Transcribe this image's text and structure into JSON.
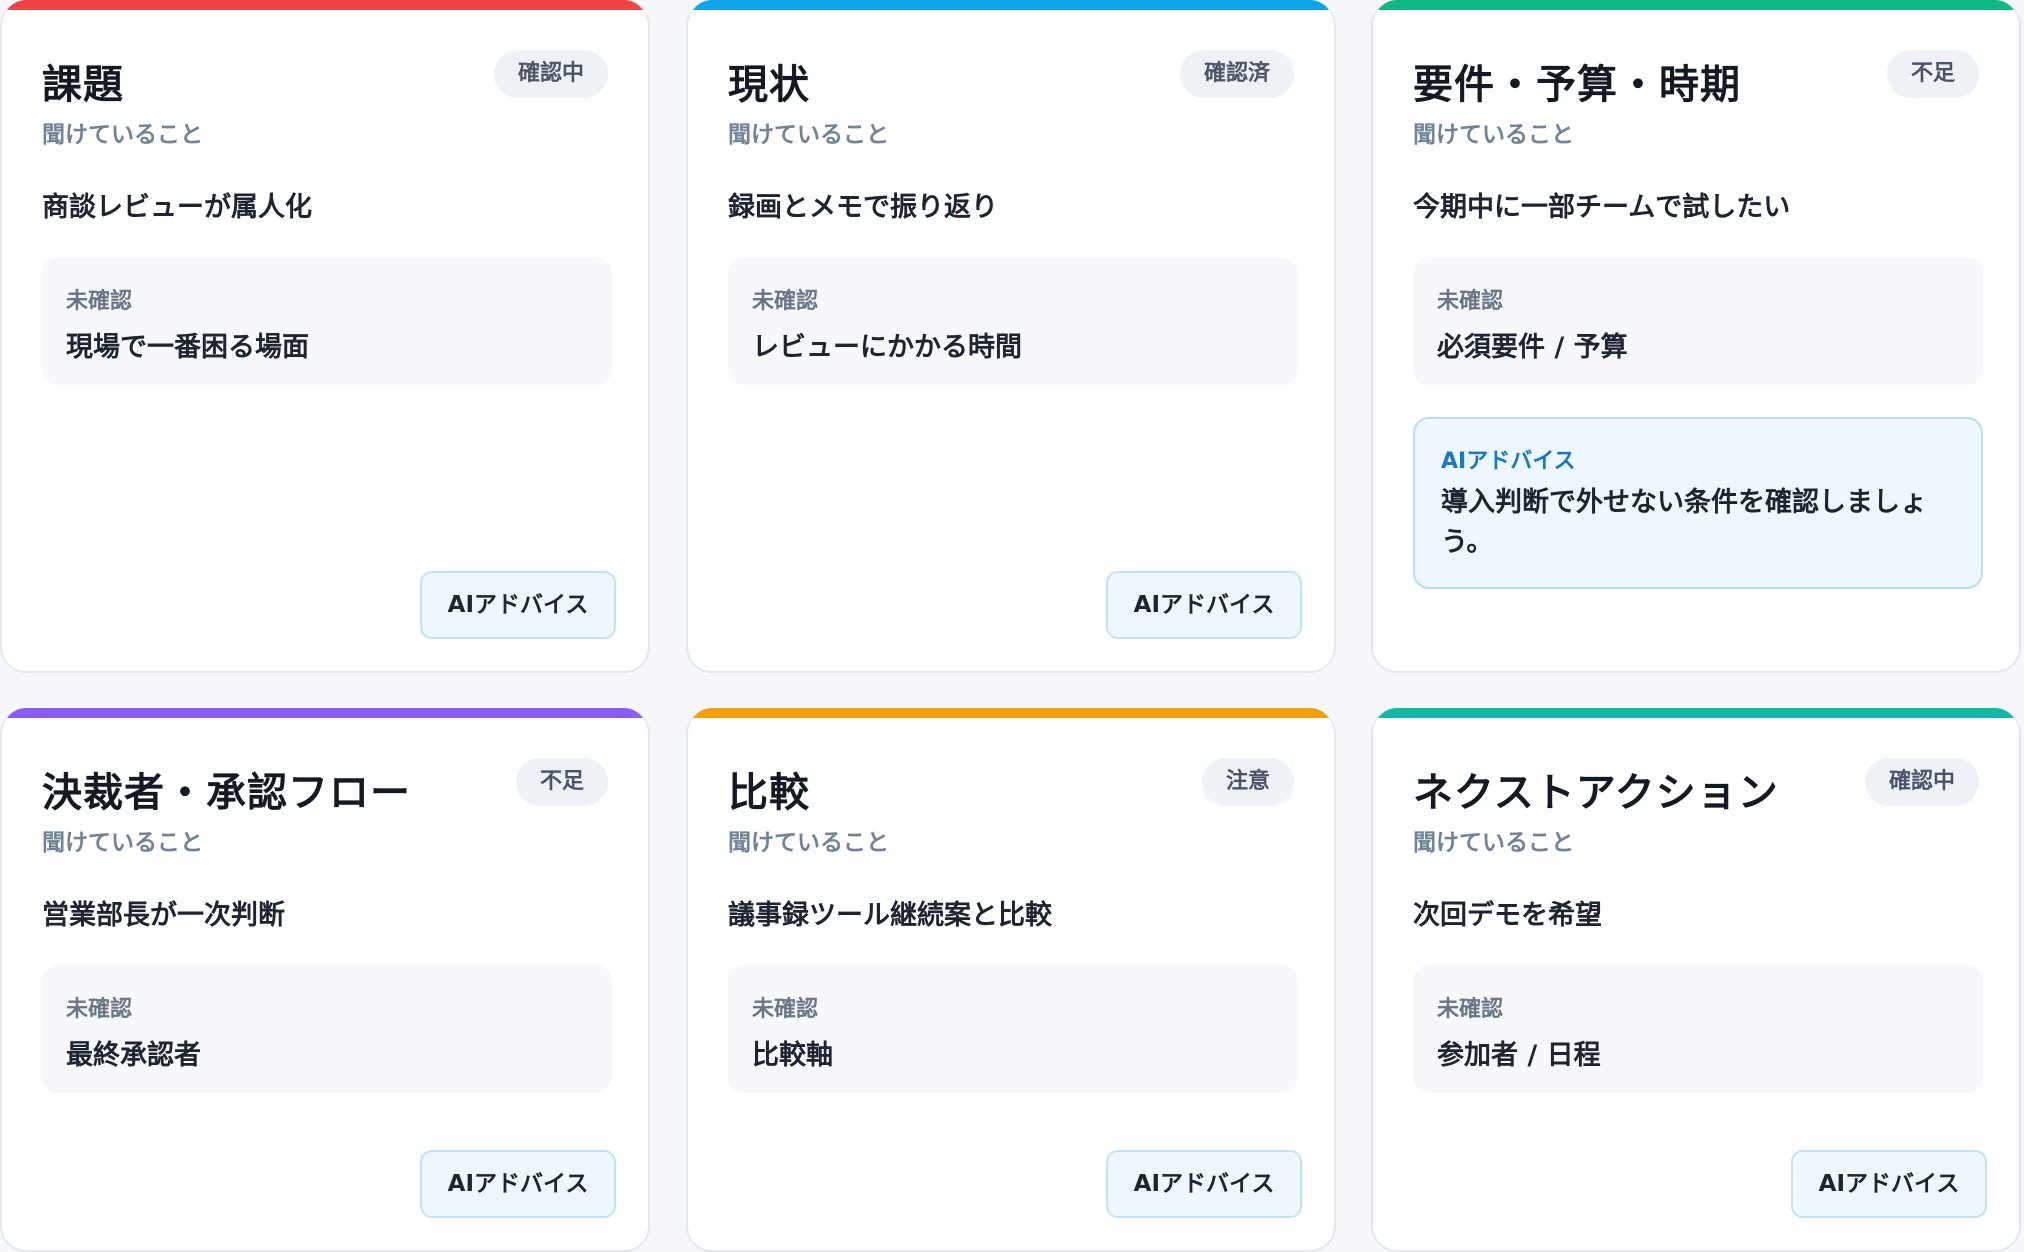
{
  "cards": [
    {
      "title": "課題",
      "status": "確認中",
      "heard_label": "聞けていること",
      "heard_value": "商談レビューが属人化",
      "unconfirmed_label": "未確認",
      "unconfirmed_value": "現場で一番困る場面",
      "ai_button_label": "AIアドバイス",
      "accent_color": "#ef4444"
    },
    {
      "title": "現状",
      "status": "確認済",
      "heard_label": "聞けていること",
      "heard_value": "録画とメモで振り返り",
      "unconfirmed_label": "未確認",
      "unconfirmed_value": "レビューにかかる時間",
      "ai_button_label": "AIアドバイス",
      "accent_color": "#0ea5e9"
    },
    {
      "title": "要件・予算・時期",
      "status": "不足",
      "heard_label": "聞けていること",
      "heard_value": "今期中に一部チームで試したい",
      "unconfirmed_label": "未確認",
      "unconfirmed_value": "必須要件 / 予算",
      "advice_label": "AIアドバイス",
      "advice_text": "導入判断で外せない条件を確認しましょう。",
      "accent_color": "#10b981"
    },
    {
      "title": "決裁者・承認フロー",
      "status": "不足",
      "heard_label": "聞けていること",
      "heard_value": "営業部長が一次判断",
      "unconfirmed_label": "未確認",
      "unconfirmed_value": "最終承認者",
      "ai_button_label": "AIアドバイス",
      "accent_color": "#8b5cf6"
    },
    {
      "title": "比較",
      "status": "注意",
      "heard_label": "聞けていること",
      "heard_value": "議事録ツール継続案と比較",
      "unconfirmed_label": "未確認",
      "unconfirmed_value": "比較軸",
      "ai_button_label": "AIアドバイス",
      "accent_color": "#f59e0b"
    },
    {
      "title": "ネクストアクション",
      "status": "確認中",
      "heard_label": "聞けていること",
      "heard_value": "次回デモを希望",
      "unconfirmed_label": "未確認",
      "unconfirmed_value": "参加者 / 日程",
      "ai_button_label": "AIアドバイス",
      "accent_color": "#14b8a6"
    }
  ]
}
